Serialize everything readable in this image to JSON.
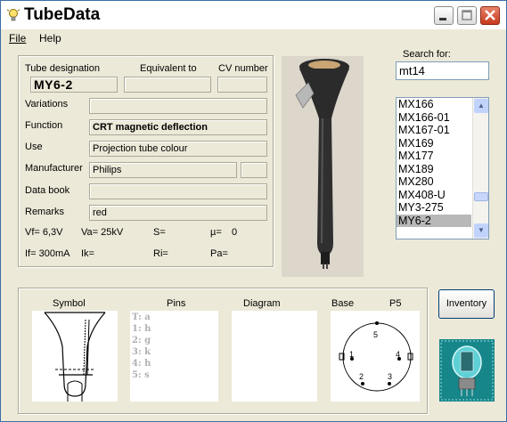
{
  "window": {
    "title": "TubeData"
  },
  "menu": {
    "file": "File",
    "help": "Help"
  },
  "labels": {
    "tube_designation": "Tube designation",
    "equivalent_to": "Equivalent to",
    "cv_number": "CV number",
    "variations": "Variations",
    "function": "Function",
    "use": "Use",
    "manufacturer": "Manufacturer",
    "data_book": "Data book",
    "remarks": "Remarks",
    "vf": "Vf= 6,3V",
    "va": "Va= 25kV",
    "s": "S=",
    "mu": "µ=",
    "mu_value": "0",
    "if": "If= 300mA",
    "ik": "Ik=",
    "ri": "Ri=",
    "pa": "Pa="
  },
  "fields": {
    "tube_designation": "MY6-2",
    "equivalent_to": "",
    "cv_number": "",
    "variations": "",
    "function": "CRT magnetic deflection",
    "use": "Projection tube colour",
    "manufacturer": "Philips",
    "manufacturer_extra": "",
    "data_book": "",
    "remarks": "red"
  },
  "search": {
    "label": "Search for:",
    "value": "mt14"
  },
  "tube_list": {
    "items": [
      "MX166",
      "MX166-01",
      "MX167-01",
      "MX169",
      "MX177",
      "MX189",
      "MX280",
      "MX408-U",
      "MY3-275",
      "MY6-2"
    ],
    "selected": "MY6-2"
  },
  "bottom": {
    "symbol": "Symbol",
    "pins": "Pins",
    "diagram": "Diagram",
    "base": "Base",
    "base_type": "P5",
    "pin_list": [
      "T: a",
      "1: h",
      "2: g",
      "3: k",
      "4: h",
      "5: s"
    ],
    "base_pins": [
      "5",
      "1",
      "4",
      "2",
      "3"
    ]
  },
  "inventory_button": "Inventory",
  "icons": {
    "app": "bulb-icon",
    "minimize": "minimize-icon",
    "maximize": "maximize-icon",
    "close": "close-icon"
  }
}
